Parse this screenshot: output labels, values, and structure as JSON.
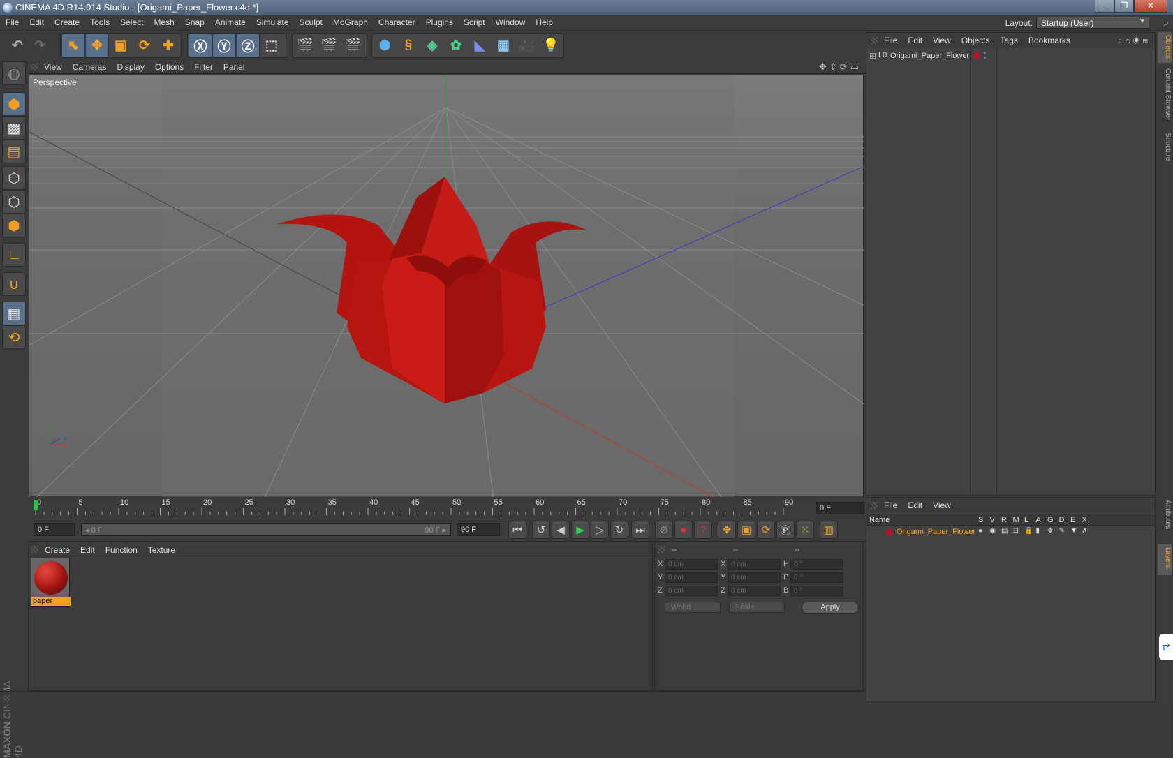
{
  "window": {
    "title": "CINEMA 4D R14.014 Studio - [Origami_Paper_Flower.c4d *]",
    "minimize": "─",
    "maximize": "❐",
    "close": "✕"
  },
  "menubar": {
    "items": [
      "File",
      "Edit",
      "Create",
      "Tools",
      "Select",
      "Mesh",
      "Snap",
      "Animate",
      "Simulate",
      "Sculpt",
      "MoGraph",
      "Character",
      "Plugins",
      "Script",
      "Window",
      "Help"
    ],
    "layout_label": "Layout:",
    "layout_value": "Startup (User)"
  },
  "viewport": {
    "menu": [
      "View",
      "Cameras",
      "Display",
      "Options",
      "Filter",
      "Panel"
    ],
    "label": "Perspective",
    "axis_y": "y",
    "axis_z": "z",
    "axis_x": "x",
    "object_color": "#c01a18"
  },
  "timeline": {
    "ticks": [
      "0",
      "5",
      "10",
      "15",
      "20",
      "25",
      "30",
      "35",
      "40",
      "45",
      "50",
      "55",
      "60",
      "65",
      "70",
      "75",
      "80",
      "85",
      "90"
    ],
    "current_frame": "0 F",
    "start_field": "0 F",
    "range_start": "◂ 0 F",
    "range_end": "90 F ▸",
    "end_field": "90 F"
  },
  "material_panel": {
    "menu": [
      "Create",
      "Edit",
      "Function",
      "Texture"
    ],
    "material_name": "paper"
  },
  "coords": {
    "headers": [
      "--",
      "--",
      "--"
    ],
    "rows": [
      {
        "l1": "X",
        "v1": "0 cm",
        "l2": "X",
        "v2": "0 cm",
        "l3": "H",
        "v3": "0 °"
      },
      {
        "l1": "Y",
        "v1": "0 cm",
        "l2": "Y",
        "v2": "0 cm",
        "l3": "P",
        "v3": "0 °"
      },
      {
        "l1": "Z",
        "v1": "0 cm",
        "l2": "Z",
        "v2": "0 cm",
        "l3": "B",
        "v3": "0 °"
      }
    ],
    "world": "World",
    "scale": "Scale",
    "apply": "Apply"
  },
  "objects_panel": {
    "menu": [
      "File",
      "Edit",
      "View",
      "Objects",
      "Tags",
      "Bookmarks"
    ],
    "object_name": "Origami_Paper_Flower"
  },
  "layers_panel": {
    "menu": [
      "File",
      "Edit",
      "View"
    ],
    "name_header": "Name",
    "col_headers": [
      "S",
      "V",
      "R",
      "M",
      "L",
      "A",
      "G",
      "D",
      "E",
      "X"
    ],
    "layer_name": "Origami_Paper_Flower"
  },
  "right_tabs": [
    "Objects",
    "Content Browser",
    "Structure",
    "Attributes",
    "Layers"
  ],
  "logo": {
    "line1": "MAXON",
    "line2": "CINEMA 4D"
  }
}
